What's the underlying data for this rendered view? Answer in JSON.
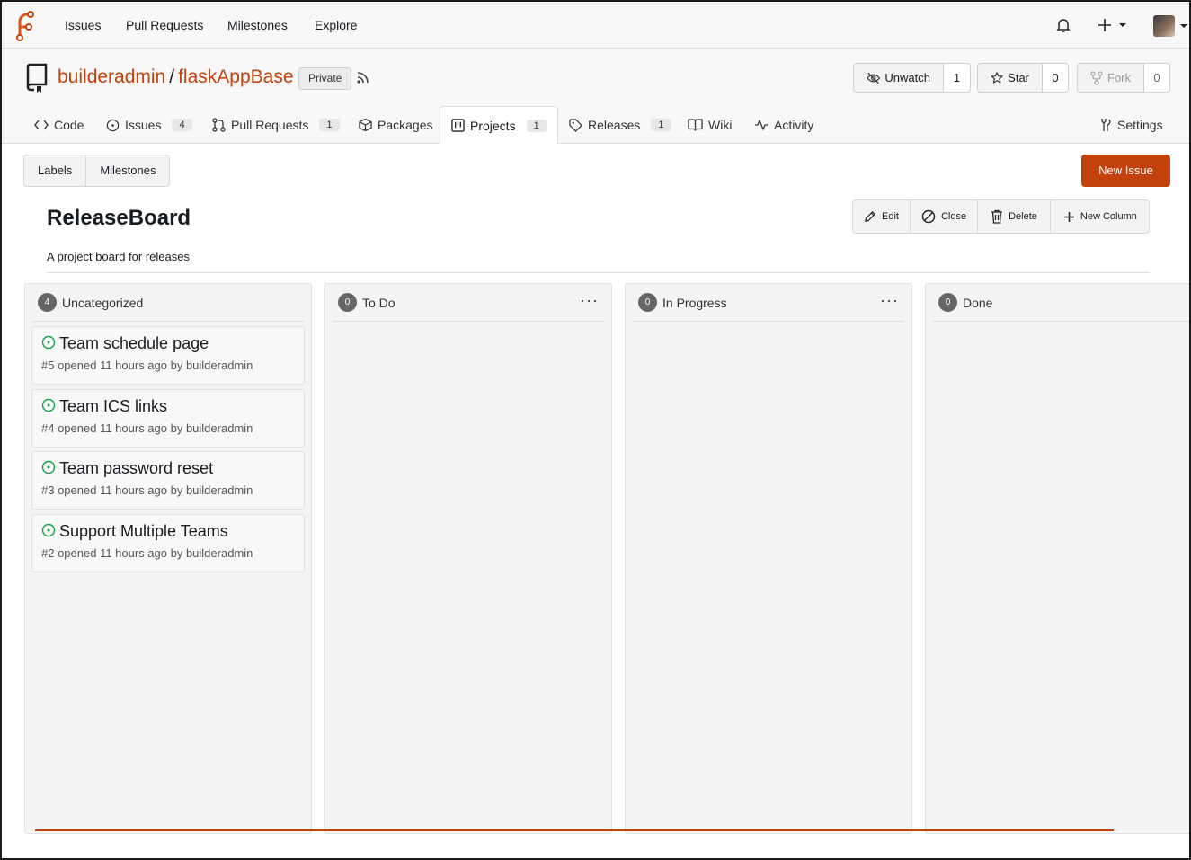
{
  "nav": {
    "items": [
      "Issues",
      "Pull Requests",
      "Milestones",
      "Explore"
    ],
    "brand_color": "#c2410c"
  },
  "repo": {
    "owner": "builderadmin",
    "separator": "/",
    "name": "flaskAppBase",
    "visibility": "Private",
    "watch": {
      "label": "Unwatch",
      "count": "1"
    },
    "star": {
      "label": "Star",
      "count": "0"
    },
    "fork": {
      "label": "Fork",
      "count": "0"
    }
  },
  "tabs": [
    {
      "label": "Code",
      "icon": "code-icon",
      "count": null
    },
    {
      "label": "Issues",
      "icon": "issue-icon",
      "count": "4"
    },
    {
      "label": "Pull Requests",
      "icon": "pull-request-icon",
      "count": "1"
    },
    {
      "label": "Packages",
      "icon": "package-icon",
      "count": null
    },
    {
      "label": "Projects",
      "icon": "project-icon",
      "count": "1",
      "active": true
    },
    {
      "label": "Releases",
      "icon": "tag-icon",
      "count": "1"
    },
    {
      "label": "Wiki",
      "icon": "book-icon",
      "count": null
    },
    {
      "label": "Activity",
      "icon": "pulse-icon",
      "count": null
    }
  ],
  "settings_label": "Settings",
  "subnav": {
    "labels": "Labels",
    "milestones": "Milestones"
  },
  "new_issue_label": "New Issue",
  "project": {
    "title": "ReleaseBoard",
    "description": "A project board for releases",
    "actions": {
      "edit": "Edit",
      "close": "Close",
      "delete": "Delete",
      "new_column": "New Column"
    }
  },
  "columns": [
    {
      "title": "Uncategorized",
      "count": "4",
      "cards": [
        {
          "title": "Team schedule page",
          "meta": "#5 opened 11 hours ago by builderadmin"
        },
        {
          "title": "Team ICS links",
          "meta": "#4 opened 11 hours ago by builderadmin"
        },
        {
          "title": "Team password reset",
          "meta": "#3 opened 11 hours ago by builderadmin"
        },
        {
          "title": "Support Multiple Teams",
          "meta": "#2 opened 11 hours ago by builderadmin"
        }
      ]
    },
    {
      "title": "To Do",
      "count": "0",
      "menu": "···",
      "cards": []
    },
    {
      "title": "In Progress",
      "count": "0",
      "menu": "···",
      "cards": []
    },
    {
      "title": "Done",
      "count": "0",
      "cards": []
    }
  ]
}
